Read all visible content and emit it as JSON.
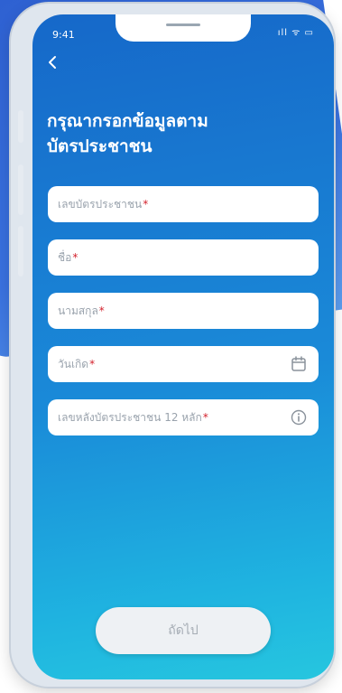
{
  "status": {
    "time": "9:41",
    "signal": "ıll ᯤ ▭"
  },
  "header": {
    "back_icon": "chevron-left-icon",
    "title_line1": "กรุณากรอกข้อมูลตาม",
    "title_line2": "บัตรประชาชน"
  },
  "fields": [
    {
      "placeholder": "เลขบัตรประชาชน",
      "required": "*"
    },
    {
      "placeholder": "ชื่อ",
      "required": "*"
    },
    {
      "placeholder": "นามสกุล",
      "required": "*"
    },
    {
      "placeholder": "วันเกิด",
      "required": "*",
      "icon": "calendar-icon"
    },
    {
      "placeholder": "เลขหลังบัตรประชาชน 12 หลัก",
      "required": "*",
      "icon": "info-icon"
    }
  ],
  "footer": {
    "next_label": "ถัดไป"
  },
  "colors": {
    "gradient_start": "#1668c9",
    "gradient_end": "#26c6df",
    "required": "#d3212c"
  }
}
